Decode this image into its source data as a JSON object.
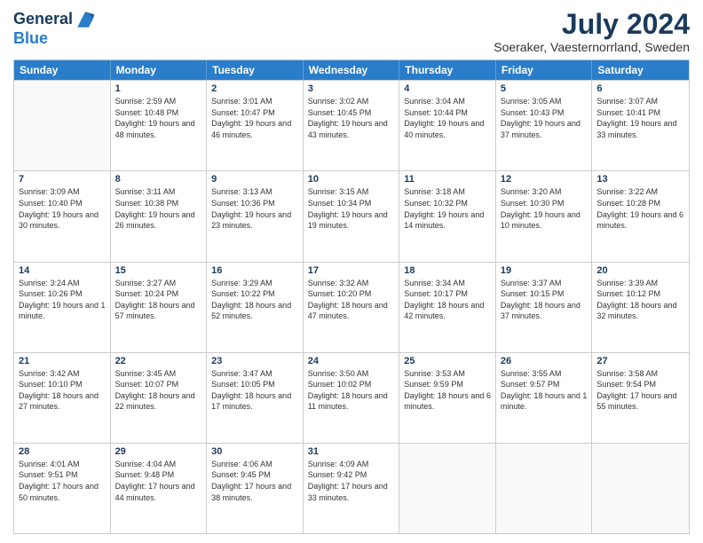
{
  "header": {
    "logo_line1": "General",
    "logo_line2": "Blue",
    "month": "July 2024",
    "location": "Soeraker, Vaesternorrland, Sweden"
  },
  "weekdays": [
    "Sunday",
    "Monday",
    "Tuesday",
    "Wednesday",
    "Thursday",
    "Friday",
    "Saturday"
  ],
  "weeks": [
    [
      {
        "day": "",
        "empty": true
      },
      {
        "day": "1",
        "sunrise": "Sunrise: 2:59 AM",
        "sunset": "Sunset: 10:48 PM",
        "daylight": "Daylight: 19 hours and 48 minutes."
      },
      {
        "day": "2",
        "sunrise": "Sunrise: 3:01 AM",
        "sunset": "Sunset: 10:47 PM",
        "daylight": "Daylight: 19 hours and 46 minutes."
      },
      {
        "day": "3",
        "sunrise": "Sunrise: 3:02 AM",
        "sunset": "Sunset: 10:45 PM",
        "daylight": "Daylight: 19 hours and 43 minutes."
      },
      {
        "day": "4",
        "sunrise": "Sunrise: 3:04 AM",
        "sunset": "Sunset: 10:44 PM",
        "daylight": "Daylight: 19 hours and 40 minutes."
      },
      {
        "day": "5",
        "sunrise": "Sunrise: 3:05 AM",
        "sunset": "Sunset: 10:43 PM",
        "daylight": "Daylight: 19 hours and 37 minutes."
      },
      {
        "day": "6",
        "sunrise": "Sunrise: 3:07 AM",
        "sunset": "Sunset: 10:41 PM",
        "daylight": "Daylight: 19 hours and 33 minutes."
      }
    ],
    [
      {
        "day": "7",
        "sunrise": "Sunrise: 3:09 AM",
        "sunset": "Sunset: 10:40 PM",
        "daylight": "Daylight: 19 hours and 30 minutes."
      },
      {
        "day": "8",
        "sunrise": "Sunrise: 3:11 AM",
        "sunset": "Sunset: 10:38 PM",
        "daylight": "Daylight: 19 hours and 26 minutes."
      },
      {
        "day": "9",
        "sunrise": "Sunrise: 3:13 AM",
        "sunset": "Sunset: 10:36 PM",
        "daylight": "Daylight: 19 hours and 23 minutes."
      },
      {
        "day": "10",
        "sunrise": "Sunrise: 3:15 AM",
        "sunset": "Sunset: 10:34 PM",
        "daylight": "Daylight: 19 hours and 19 minutes."
      },
      {
        "day": "11",
        "sunrise": "Sunrise: 3:18 AM",
        "sunset": "Sunset: 10:32 PM",
        "daylight": "Daylight: 19 hours and 14 minutes."
      },
      {
        "day": "12",
        "sunrise": "Sunrise: 3:20 AM",
        "sunset": "Sunset: 10:30 PM",
        "daylight": "Daylight: 19 hours and 10 minutes."
      },
      {
        "day": "13",
        "sunrise": "Sunrise: 3:22 AM",
        "sunset": "Sunset: 10:28 PM",
        "daylight": "Daylight: 19 hours and 6 minutes."
      }
    ],
    [
      {
        "day": "14",
        "sunrise": "Sunrise: 3:24 AM",
        "sunset": "Sunset: 10:26 PM",
        "daylight": "Daylight: 19 hours and 1 minute."
      },
      {
        "day": "15",
        "sunrise": "Sunrise: 3:27 AM",
        "sunset": "Sunset: 10:24 PM",
        "daylight": "Daylight: 18 hours and 57 minutes."
      },
      {
        "day": "16",
        "sunrise": "Sunrise: 3:29 AM",
        "sunset": "Sunset: 10:22 PM",
        "daylight": "Daylight: 18 hours and 52 minutes."
      },
      {
        "day": "17",
        "sunrise": "Sunrise: 3:32 AM",
        "sunset": "Sunset: 10:20 PM",
        "daylight": "Daylight: 18 hours and 47 minutes."
      },
      {
        "day": "18",
        "sunrise": "Sunrise: 3:34 AM",
        "sunset": "Sunset: 10:17 PM",
        "daylight": "Daylight: 18 hours and 42 minutes."
      },
      {
        "day": "19",
        "sunrise": "Sunrise: 3:37 AM",
        "sunset": "Sunset: 10:15 PM",
        "daylight": "Daylight: 18 hours and 37 minutes."
      },
      {
        "day": "20",
        "sunrise": "Sunrise: 3:39 AM",
        "sunset": "Sunset: 10:12 PM",
        "daylight": "Daylight: 18 hours and 32 minutes."
      }
    ],
    [
      {
        "day": "21",
        "sunrise": "Sunrise: 3:42 AM",
        "sunset": "Sunset: 10:10 PM",
        "daylight": "Daylight: 18 hours and 27 minutes."
      },
      {
        "day": "22",
        "sunrise": "Sunrise: 3:45 AM",
        "sunset": "Sunset: 10:07 PM",
        "daylight": "Daylight: 18 hours and 22 minutes."
      },
      {
        "day": "23",
        "sunrise": "Sunrise: 3:47 AM",
        "sunset": "Sunset: 10:05 PM",
        "daylight": "Daylight: 18 hours and 17 minutes."
      },
      {
        "day": "24",
        "sunrise": "Sunrise: 3:50 AM",
        "sunset": "Sunset: 10:02 PM",
        "daylight": "Daylight: 18 hours and 11 minutes."
      },
      {
        "day": "25",
        "sunrise": "Sunrise: 3:53 AM",
        "sunset": "Sunset: 9:59 PM",
        "daylight": "Daylight: 18 hours and 6 minutes."
      },
      {
        "day": "26",
        "sunrise": "Sunrise: 3:55 AM",
        "sunset": "Sunset: 9:57 PM",
        "daylight": "Daylight: 18 hours and 1 minute."
      },
      {
        "day": "27",
        "sunrise": "Sunrise: 3:58 AM",
        "sunset": "Sunset: 9:54 PM",
        "daylight": "Daylight: 17 hours and 55 minutes."
      }
    ],
    [
      {
        "day": "28",
        "sunrise": "Sunrise: 4:01 AM",
        "sunset": "Sunset: 9:51 PM",
        "daylight": "Daylight: 17 hours and 50 minutes."
      },
      {
        "day": "29",
        "sunrise": "Sunrise: 4:04 AM",
        "sunset": "Sunset: 9:48 PM",
        "daylight": "Daylight: 17 hours and 44 minutes."
      },
      {
        "day": "30",
        "sunrise": "Sunrise: 4:06 AM",
        "sunset": "Sunset: 9:45 PM",
        "daylight": "Daylight: 17 hours and 38 minutes."
      },
      {
        "day": "31",
        "sunrise": "Sunrise: 4:09 AM",
        "sunset": "Sunset: 9:42 PM",
        "daylight": "Daylight: 17 hours and 33 minutes."
      },
      {
        "day": "",
        "empty": true
      },
      {
        "day": "",
        "empty": true
      },
      {
        "day": "",
        "empty": true
      }
    ]
  ]
}
